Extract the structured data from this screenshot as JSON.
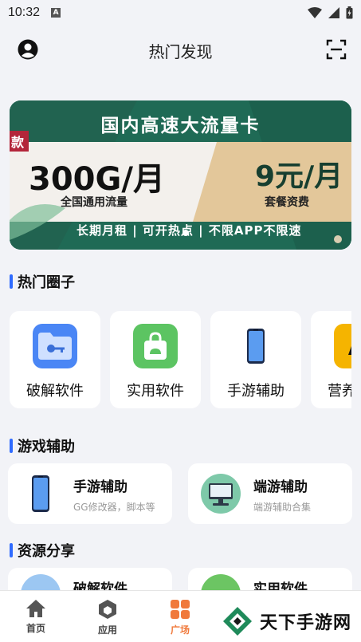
{
  "status_bar": {
    "time": "10:32",
    "notification_letter": "A"
  },
  "header": {
    "title": "热门发现"
  },
  "banner": {
    "title": "国内高速大流量卡",
    "tag": "款",
    "left_price": "300G/月",
    "left_sub": "全国通用流量",
    "right_price": "9元/月",
    "right_sub": "套餐资费",
    "footer": "长期月租 | 可开热点 | 不限APP不限速"
  },
  "sections": {
    "hot_circles": "热门圈子",
    "game_assist": "游戏辅助",
    "resources": "资源分享"
  },
  "circles": [
    {
      "label": "破解软件",
      "icon": "folder-key-icon"
    },
    {
      "label": "实用软件",
      "icon": "shopping-bag-icon"
    },
    {
      "label": "手游辅助",
      "icon": "phone-icon"
    },
    {
      "label": "营养",
      "icon": "partial-icon"
    }
  ],
  "game_cards": [
    {
      "title": "手游辅助",
      "desc": "GG修改器，脚本等"
    },
    {
      "title": "端游辅助",
      "desc": "端游辅助合集"
    }
  ],
  "resource_cards": [
    {
      "title": "破解软件"
    },
    {
      "title": "实用软件"
    }
  ],
  "nav": [
    {
      "label": "首页",
      "icon": "home-icon"
    },
    {
      "label": "应用",
      "icon": "cube-icon"
    },
    {
      "label": "广场",
      "icon": "grid-icon"
    }
  ],
  "watermark": {
    "text": "天下手游网"
  },
  "colors": {
    "accent": "#2f6bff",
    "active_nav": "#f07a3c",
    "banner_green": "#1f6a55"
  }
}
